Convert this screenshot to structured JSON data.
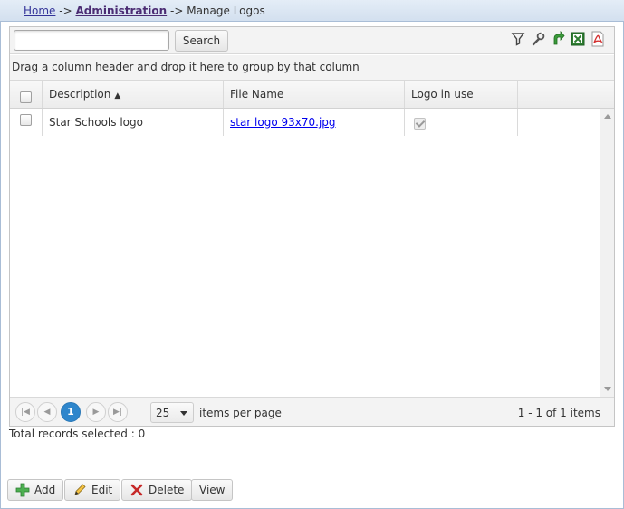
{
  "breadcrumb": {
    "home": "Home",
    "sep1": "->",
    "admin": "Administration",
    "sep2": "->",
    "current": "Manage Logos"
  },
  "toolbar": {
    "search_placeholder": "",
    "search_label": "Search",
    "icons": [
      "filter-icon",
      "wrench-icon",
      "refresh-icon",
      "excel-export-icon",
      "pdf-export-icon"
    ]
  },
  "grid": {
    "group_hint": "Drag a column header and drop it here to group by that column",
    "columns": [
      "Description",
      "File Name",
      "Logo in use"
    ],
    "sort_indicator": "▲",
    "rows": [
      {
        "description": "Star Schools logo",
        "file_name": "star logo 93x70.jpg",
        "logo_in_use": true
      }
    ]
  },
  "pager": {
    "current_page": "1",
    "page_size": "25",
    "per_page_label": "items per page",
    "info": "1 - 1 of 1 items"
  },
  "footer": {
    "total_selected": "Total records selected : 0"
  },
  "actions": {
    "add": "Add",
    "edit": "Edit",
    "delete": "Delete",
    "view": "View"
  },
  "colors": {
    "accent": "#2e86cc",
    "breadcrumb_bg": "#d3e0ef",
    "link": "#0000ee"
  }
}
